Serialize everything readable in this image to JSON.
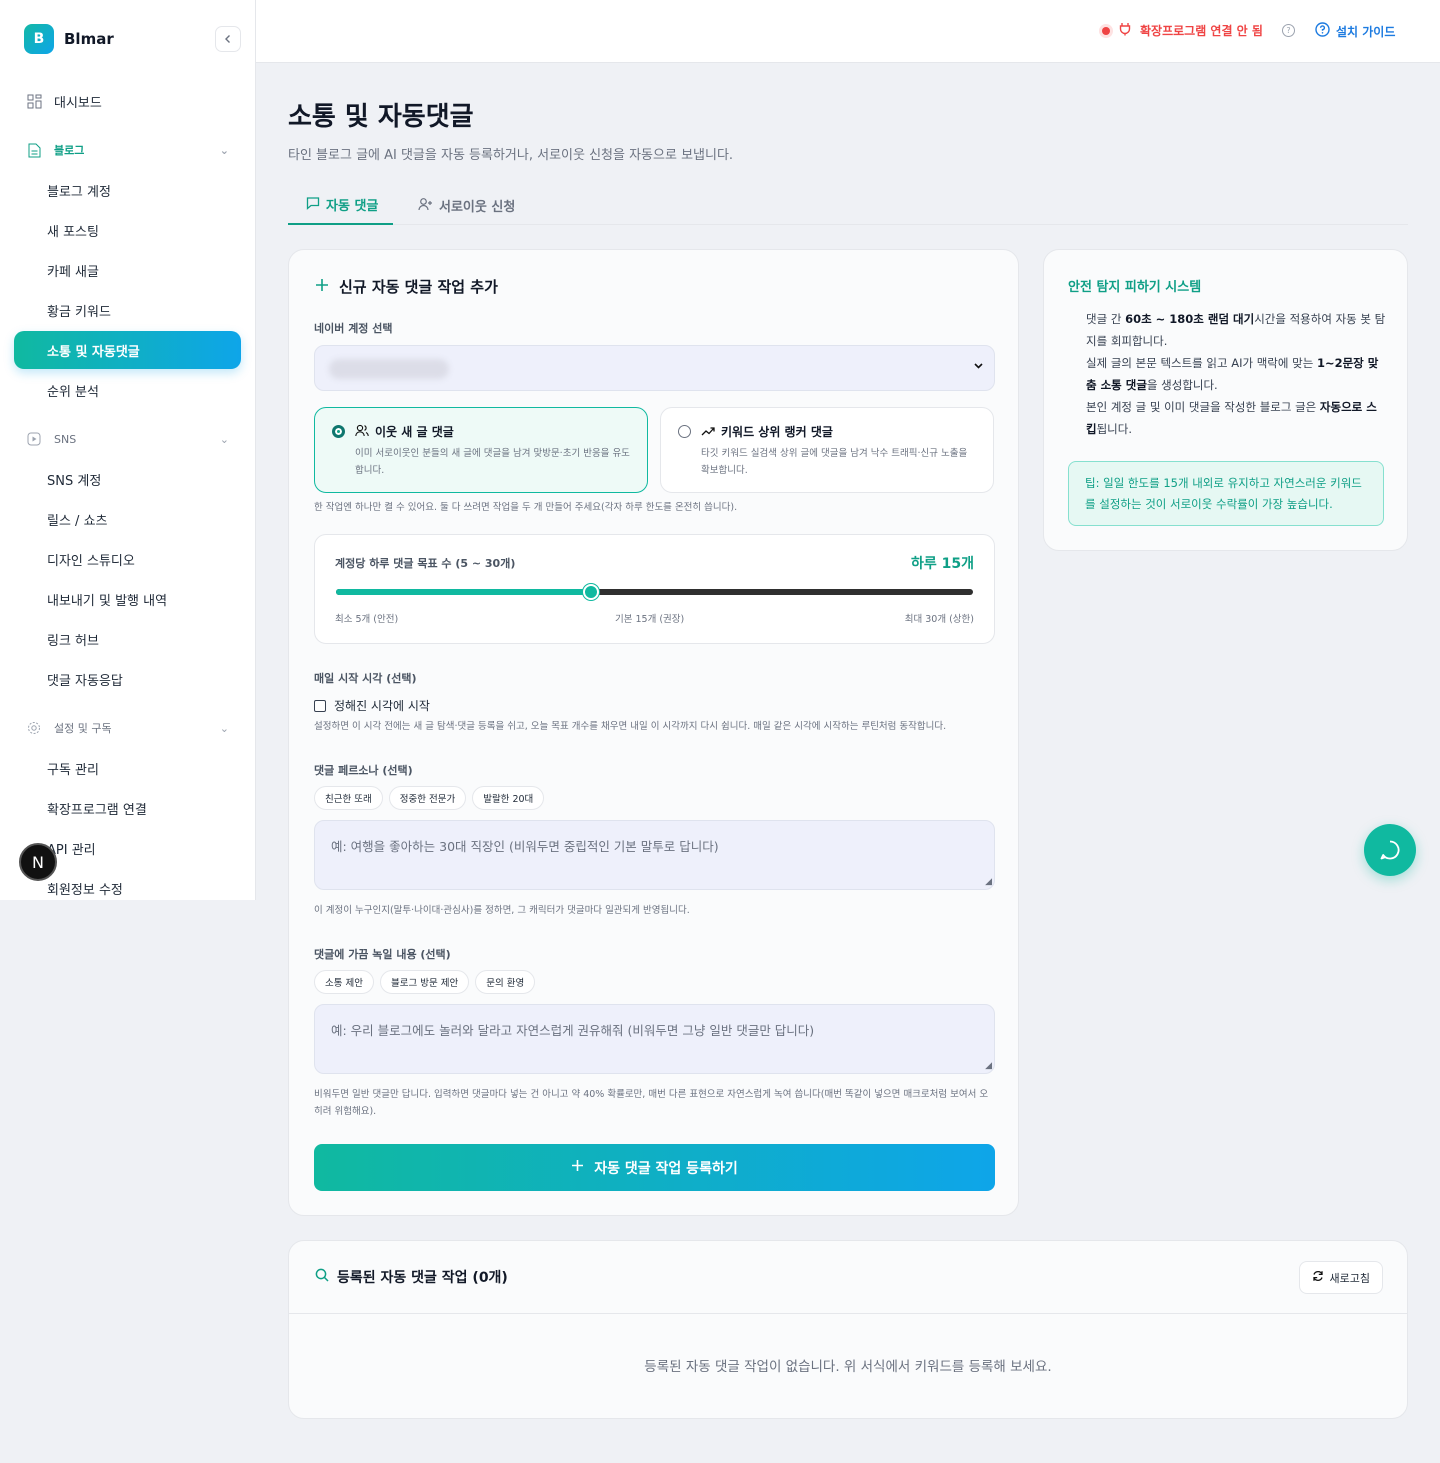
{
  "brand": {
    "logo_letter": "B",
    "name": "Blmar"
  },
  "sidebar": {
    "dashboard": "대시보드",
    "blog_section": "블로그",
    "blog_items": [
      "블로그 계정",
      "새 포스팅",
      "카페 새글",
      "황금 키워드",
      "소통 및 자동댓글",
      "순위 분석"
    ],
    "sns_section": "SNS",
    "sns_items": [
      "SNS 계정",
      "릴스 / 쇼츠",
      "디자인 스튜디오",
      "내보내기 및 발행 내역",
      "링크 허브",
      "댓글 자동응답"
    ],
    "settings_section": "설정 및 구독",
    "settings_items": [
      "구독 관리",
      "확장프로그램 연결",
      "API 관리",
      "회원정보 수정"
    ],
    "overlay_badge": "N"
  },
  "topbar": {
    "connection_status": "확장프로그램 연결 안 됨",
    "help_glyph": "?",
    "guide_label": "설치 가이드"
  },
  "page": {
    "title": "소통 및 자동댓글",
    "subtitle": "타인 블로그 글에 AI 댓글을 자동 등록하거나, 서로이웃 신청을 자동으로 보냅니다.",
    "tabs": [
      "자동 댓글",
      "서로이웃 신청"
    ]
  },
  "form": {
    "title": "신규 자동 댓글 작업 추가",
    "account_label": "네이버 계정 선택",
    "options": [
      {
        "title": "이웃 새 글 댓글",
        "desc": "이미 서로이웃인 분들의 새 글에 댓글을 남겨 맞방문·초기 반응을 유도합니다."
      },
      {
        "title": "키워드 상위 랭커 댓글",
        "desc": "타깃 키워드 실검색 상위 글에 댓글을 남겨 낙수 트래픽·신규 노출을 확보합니다."
      }
    ],
    "option_note": "한 작업엔 하나만 켤 수 있어요. 둘 다 쓰려면 작업을 두 개 만들어 주세요(각자 하루 한도를 온전히 씁니다).",
    "slider": {
      "label": "계정당 하루 댓글 목표 수 (5 ~ 30개)",
      "value_text": "하루 15개",
      "min": 5,
      "max": 30,
      "value": 15,
      "min_label": "최소 5개 (안전)",
      "mid_label": "기본 15개 (권장)",
      "max_label": "최대 30개 (상한)"
    },
    "start_time_label": "매일 시작 시각 (선택)",
    "start_time_check": "정해진 시각에 시작",
    "start_time_note": "설정하면 이 시각 전에는 새 글 탐색·댓글 등록을 쉬고, 오늘 목표 개수를 채우면 내일 이 시각까지 다시 쉽니다. 매일 같은 시각에 시작하는 루틴처럼 동작합니다.",
    "persona_label": "댓글 페르소나 (선택)",
    "persona_chips": [
      "친근한 또래",
      "정중한 전문가",
      "발랄한 20대"
    ],
    "persona_placeholder": "예: 여행을 좋아하는 30대 직장인 (비워두면 중립적인 기본 말투로 답니다)",
    "persona_note": "이 계정이 누구인지(말투·나이대·관심사)를 정하면, 그 캐릭터가 댓글마다 일관되게 반영됩니다.",
    "extra_label": "댓글에 가끔 녹일 내용 (선택)",
    "extra_chips": [
      "소통 제안",
      "블로그 방문 제안",
      "문의 환영"
    ],
    "extra_placeholder": "예: 우리 블로그에도 놀러와 달라고 자연스럽게 권유해줘 (비워두면 그냥 일반 댓글만 답니다)",
    "extra_note": "비워두면 일반 댓글만 답니다. 입력하면 댓글마다 넣는 건 아니고 약 40% 확률로만, 매번 다른 표현으로 자연스럽게 녹여 씁니다(매번 똑같이 넣으면 매크로처럼 보여서 오히려 위험해요).",
    "submit_label": "자동 댓글 작업 등록하기"
  },
  "safety": {
    "title": "안전 탐지 피하기 시스템",
    "body": [
      {
        "pre": "댓글 간 ",
        "bold": "60초 ~ 180초 랜덤 대기",
        "post": "시간을 적용하여 자동 봇 탐지를 회피합니다."
      },
      {
        "pre": "실제 글의 본문 텍스트를 읽고 AI가 맥락에 맞는 ",
        "bold": "1~2문장 맞춤 소통 댓글",
        "post": "을 생성합니다."
      },
      {
        "pre": "본인 계정 글 및 이미 댓글을 작성한 블로그 글은 ",
        "bold": "자동으로 스킵",
        "post": "됩니다."
      }
    ],
    "tip": "팁: 일일 한도를 15개 내외로 유지하고 자연스러운 키워드를 설정하는 것이 서로이웃 수락률이 가장 높습니다."
  },
  "list": {
    "title": "등록된 자동 댓글 작업 (0개)",
    "refresh_label": "새로고침",
    "empty_text": "등록된 자동 댓글 작업이 없습니다. 위 서식에서 키워드를 등록해 보세요."
  }
}
